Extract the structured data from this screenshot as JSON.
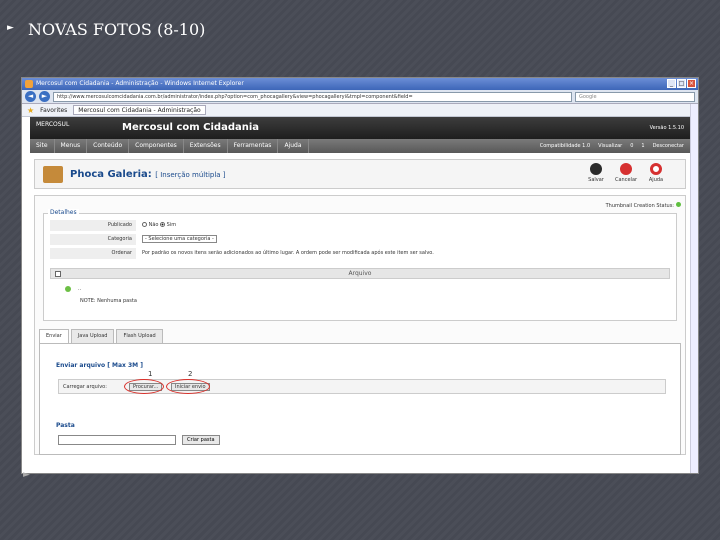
{
  "slide": {
    "title": "NOVAS FOTOS (8-10)"
  },
  "browser": {
    "window_title": "Mercosul com Cidadania - Administração - Windows Internet Explorer",
    "address": "http://www.mercosulcomcidadania.com.br/administrator/index.php?option=com_phocagallery&view=phocagalleryi&tmpl=component&field=",
    "search_placeholder": "Google",
    "favorites_label": "Favorites",
    "tab_label": "Mercosul com Cidadania - Administração"
  },
  "joomla": {
    "site_name": "Mercosul com Cidadania",
    "logo_text": "MERCOSUL",
    "version": "Versão 1.5.10",
    "menu": [
      "Site",
      "Menus",
      "Conteúdo",
      "Componentes",
      "Extensões",
      "Ferramentas",
      "Ajuda"
    ],
    "right_links": [
      "Compatibilidade 1.0",
      "Visualizar",
      "0",
      "1",
      "Desconectar"
    ]
  },
  "toolbar": {
    "title": "Phoca Galeria:",
    "subtitle": "[ Inserção múltipla ]",
    "buttons": [
      "Salvar",
      "Cancelar",
      "Ajuda"
    ]
  },
  "form": {
    "thumb_status": "Thumbnail Creation Status:",
    "legend": "Detalhes",
    "published_label": "Publicado",
    "published_options": [
      "Não",
      "Sim"
    ],
    "category_label": "Categoria",
    "category_value": "- Selecione uma categoria -",
    "order_label": "Ordenar",
    "order_text": "Por padrão os novos itens serão adicionados ao último lugar. A ordem pode ser modificada após este item ser salvo.",
    "table_header": "Arquivo",
    "file_row_text": "..",
    "folder_text": "NOTE: Nenhuma pasta"
  },
  "upload": {
    "tabs": [
      "Enviar",
      "Java Upload",
      "Flash Upload"
    ],
    "title": "Enviar arquivo [ Max 3M ]",
    "row_label": "Carregar arquivo:",
    "browse_button": "Procurar...",
    "upload_button": "Iniciar envio",
    "marker_1": "1",
    "marker_2": "2",
    "folder_title": "Pasta",
    "create_folder_button": "Criar pasta"
  }
}
